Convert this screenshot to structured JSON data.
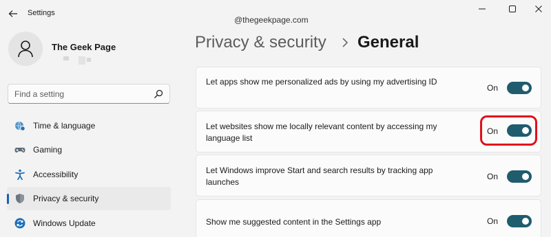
{
  "window": {
    "title": "Settings"
  },
  "watermark": "@thegeekpage.com",
  "user": {
    "name": "The Geek Page"
  },
  "search": {
    "placeholder": "Find a setting"
  },
  "sidebar": {
    "items": [
      {
        "label": "Time & language",
        "icon": "globe-clock-icon",
        "active": false
      },
      {
        "label": "Gaming",
        "icon": "gamepad-icon",
        "active": false
      },
      {
        "label": "Accessibility",
        "icon": "accessibility-icon",
        "active": false
      },
      {
        "label": "Privacy & security",
        "icon": "shield-icon",
        "active": true
      },
      {
        "label": "Windows Update",
        "icon": "update-icon",
        "active": false
      }
    ]
  },
  "header": {
    "parent": "Privacy & security",
    "separator_icon": "chevron-right-icon",
    "current": "General"
  },
  "settings": [
    {
      "label": "Let apps show me personalized ads by using my advertising ID",
      "state": "On",
      "enabled": true
    },
    {
      "label": "Let websites show me locally relevant content by accessing my language list",
      "state": "On",
      "enabled": true,
      "highlighted": true
    },
    {
      "label": "Let Windows improve Start and search results by tracking app launches",
      "state": "On",
      "enabled": true
    },
    {
      "label": "Show me suggested content in the Settings app",
      "state": "On",
      "enabled": true
    }
  ],
  "colors": {
    "toggle_on": "#1e5c6e",
    "accent": "#1a5fb4",
    "highlight": "#e0101a",
    "background": "#f3f3f3"
  }
}
